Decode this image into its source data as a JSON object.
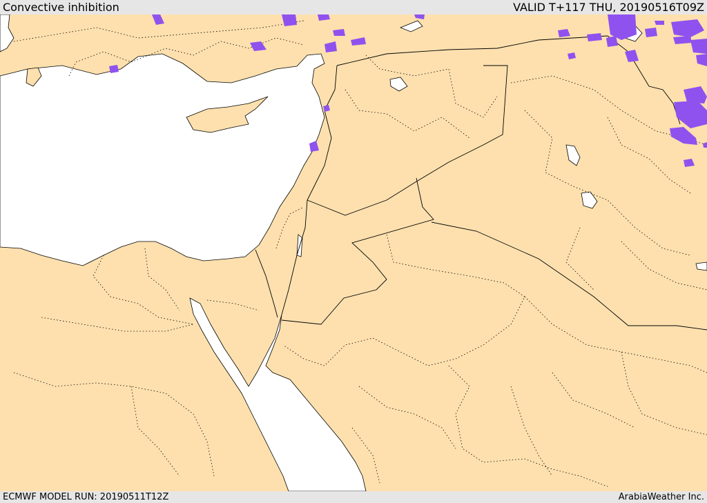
{
  "header": {
    "title": "Convective inhibition",
    "valid": "VALID T+117 THU, 20190516T09Z"
  },
  "footer": {
    "model_run": "ECMWF MODEL RUN: 20190511T12Z",
    "credit": "ArabiaWeather Inc."
  },
  "colors": {
    "land": "#fde0ae",
    "sea": "#ffffff",
    "cin": "#8f52ee",
    "border": "#000000",
    "bar": "#e6e6e6"
  }
}
